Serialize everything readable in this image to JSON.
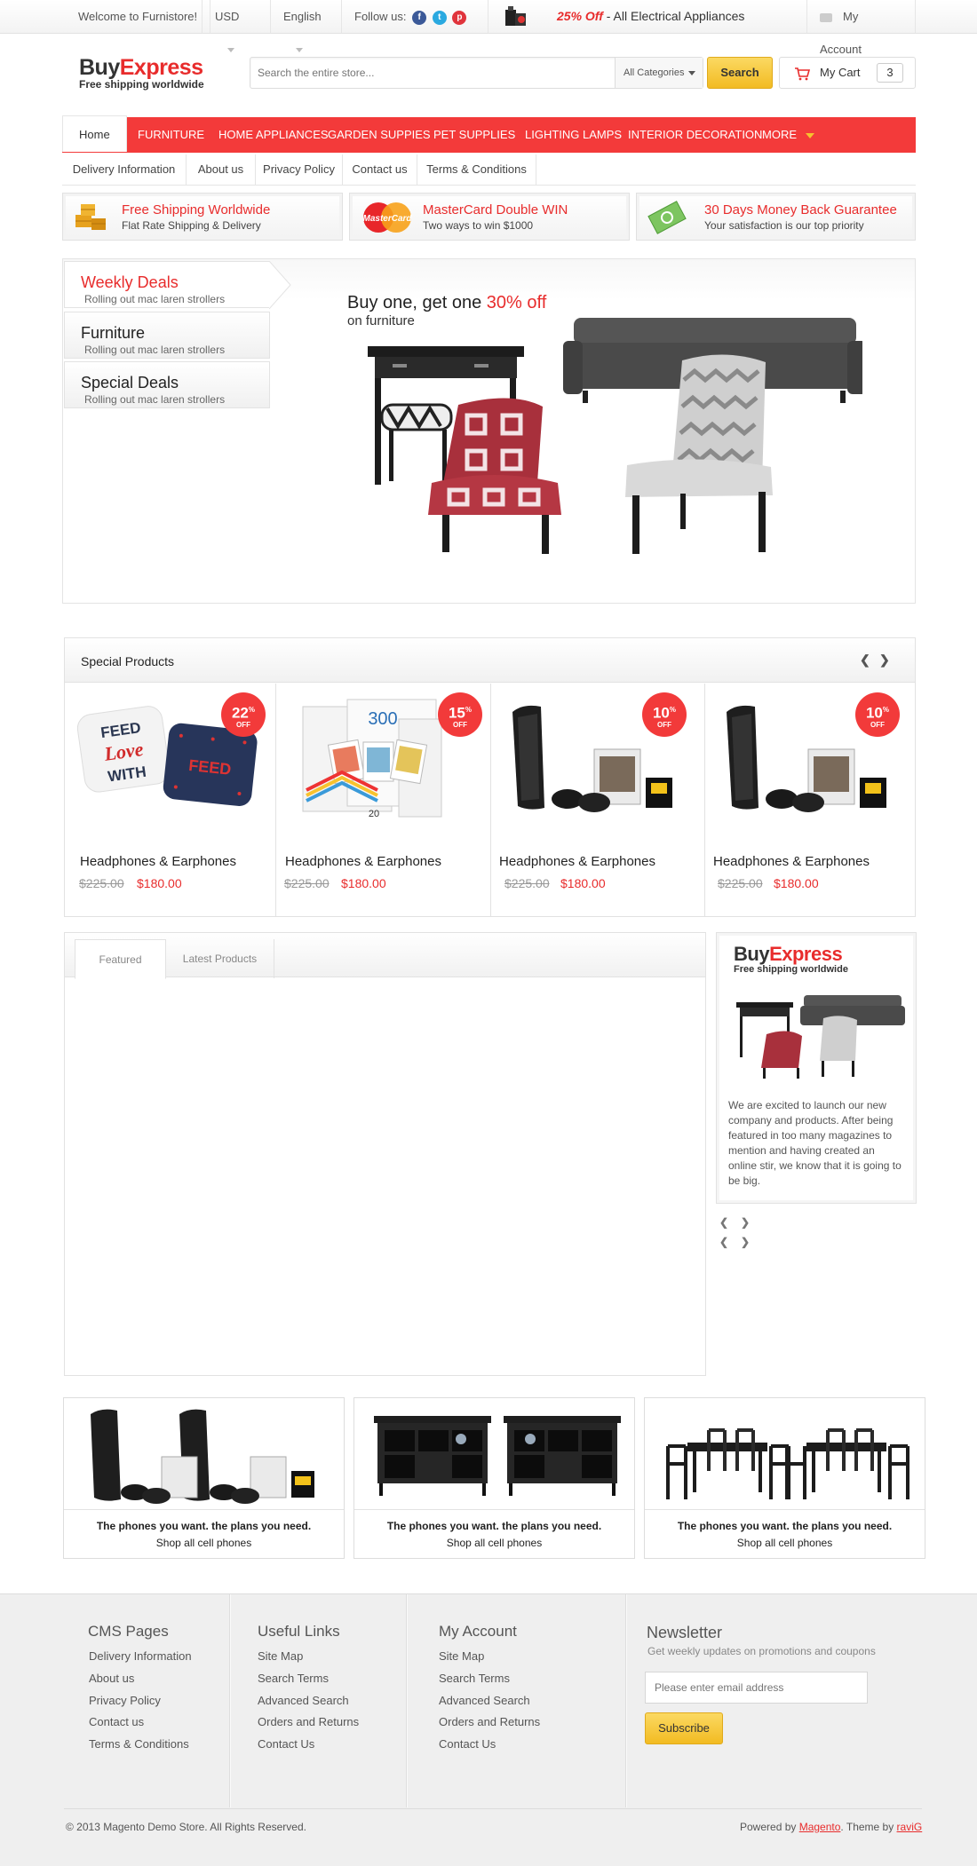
{
  "topbar": {
    "welcome": "Welcome to Furnistore!",
    "currency": "USD",
    "language": "English",
    "follow": "Follow us:",
    "promo_off": "25% Off",
    "promo_text": "- All Electrical Appliances",
    "account": "My Account"
  },
  "header": {
    "logo_buy": "Buy",
    "logo_express": "Express",
    "tagline": "Free shipping worldwide",
    "search_placeholder": "Search the entire store...",
    "categories": "All Categories",
    "search_btn": "Search",
    "cart_label": "My Cart",
    "cart_count": "3"
  },
  "nav": {
    "home": "Home",
    "items": [
      "FURNITURE",
      "HOME APPLIANCES",
      "GARDEN SUPPIES",
      "PET SUPPLIES",
      "LIGHTING LAMPS",
      "INTERIOR DECORATION",
      "MORE"
    ]
  },
  "subnav": [
    "Delivery Information",
    "About us",
    "Privacy Policy",
    "Contact us",
    "Terms & Conditions"
  ],
  "features": [
    {
      "title": "Free Shipping Worldwide",
      "desc": "Flat Rate Shipping & Delivery"
    },
    {
      "title": "MasterCard Double WIN",
      "desc": "Two ways to win $1000"
    },
    {
      "title": "30 Days Money Back Guarantee",
      "desc": "Your satisfaction is our top priority"
    }
  ],
  "slider": {
    "tabs": [
      {
        "title": "Weekly Deals",
        "desc": "Rolling out mac laren strollers"
      },
      {
        "title": "Furniture",
        "desc": "Rolling out mac laren strollers"
      },
      {
        "title": "Special Deals",
        "desc": "Rolling out mac laren strollers"
      }
    ],
    "headline_pre": "Buy one, get one ",
    "headline_pct": "30% off",
    "headline_sub": "on furniture"
  },
  "special": {
    "title": "Special Products",
    "products": [
      {
        "name": "Headphones & Earphones",
        "old": "$225.00",
        "new": "$180.00",
        "discount": "22",
        "pct": "%",
        "off": "OFF"
      },
      {
        "name": "Headphones & Earphones",
        "old": "$225.00",
        "new": "$180.00",
        "discount": "15",
        "pct": "%",
        "off": "OFF"
      },
      {
        "name": "Headphones & Earphones",
        "old": "$225.00",
        "new": "$180.00",
        "discount": "10",
        "pct": "%",
        "off": "OFF"
      },
      {
        "name": "Headphones & Earphones",
        "old": "$225.00",
        "new": "$180.00",
        "discount": "10",
        "pct": "%",
        "off": "OFF"
      }
    ]
  },
  "producttabs": {
    "featured": "Featured",
    "latest": "Latest Products"
  },
  "widget": {
    "logo_buy": "Buy",
    "logo_express": "Express",
    "tagline": "Free shipping worldwide",
    "text": "We are excited to launch our new company and products. After being featured in too many magazines to mention and having created an online stir, we know that it is going to be big."
  },
  "banners": [
    {
      "line1": "The phones you want. the plans you need.",
      "line2": "Shop all cell phones"
    },
    {
      "line1": "The phones you want. the plans you need.",
      "line2": "Shop all cell phones"
    },
    {
      "line1": "The phones you want. the plans you need.",
      "line2": "Shop all cell phones"
    }
  ],
  "footer": {
    "cms": {
      "title": "CMS Pages",
      "links": [
        "Delivery Information",
        "About us",
        "Privacy Policy",
        "Contact us",
        "Terms & Conditions"
      ]
    },
    "useful": {
      "title": "Useful Links",
      "links": [
        "Site Map",
        "Search Terms",
        "Advanced Search",
        "Orders and Returns",
        "Contact Us"
      ]
    },
    "account": {
      "title": "My Account",
      "links": [
        "Site Map",
        "Search Terms",
        "Advanced Search",
        "Orders and Returns",
        "Contact Us"
      ]
    },
    "newsletter": {
      "title": "Newsletter",
      "desc": "Get weekly updates on promotions and coupons",
      "placeholder": "Please enter email address",
      "button": "Subscribe"
    },
    "copyright": "© 2013 Magento Demo Store. All Rights Reserved.",
    "powered": "Powered by ",
    "magento": "Magento",
    "theme": ". Theme by ",
    "author": "raviG"
  },
  "colors": {
    "accent": "#f33a3a",
    "yellow": "#f5c22e"
  }
}
